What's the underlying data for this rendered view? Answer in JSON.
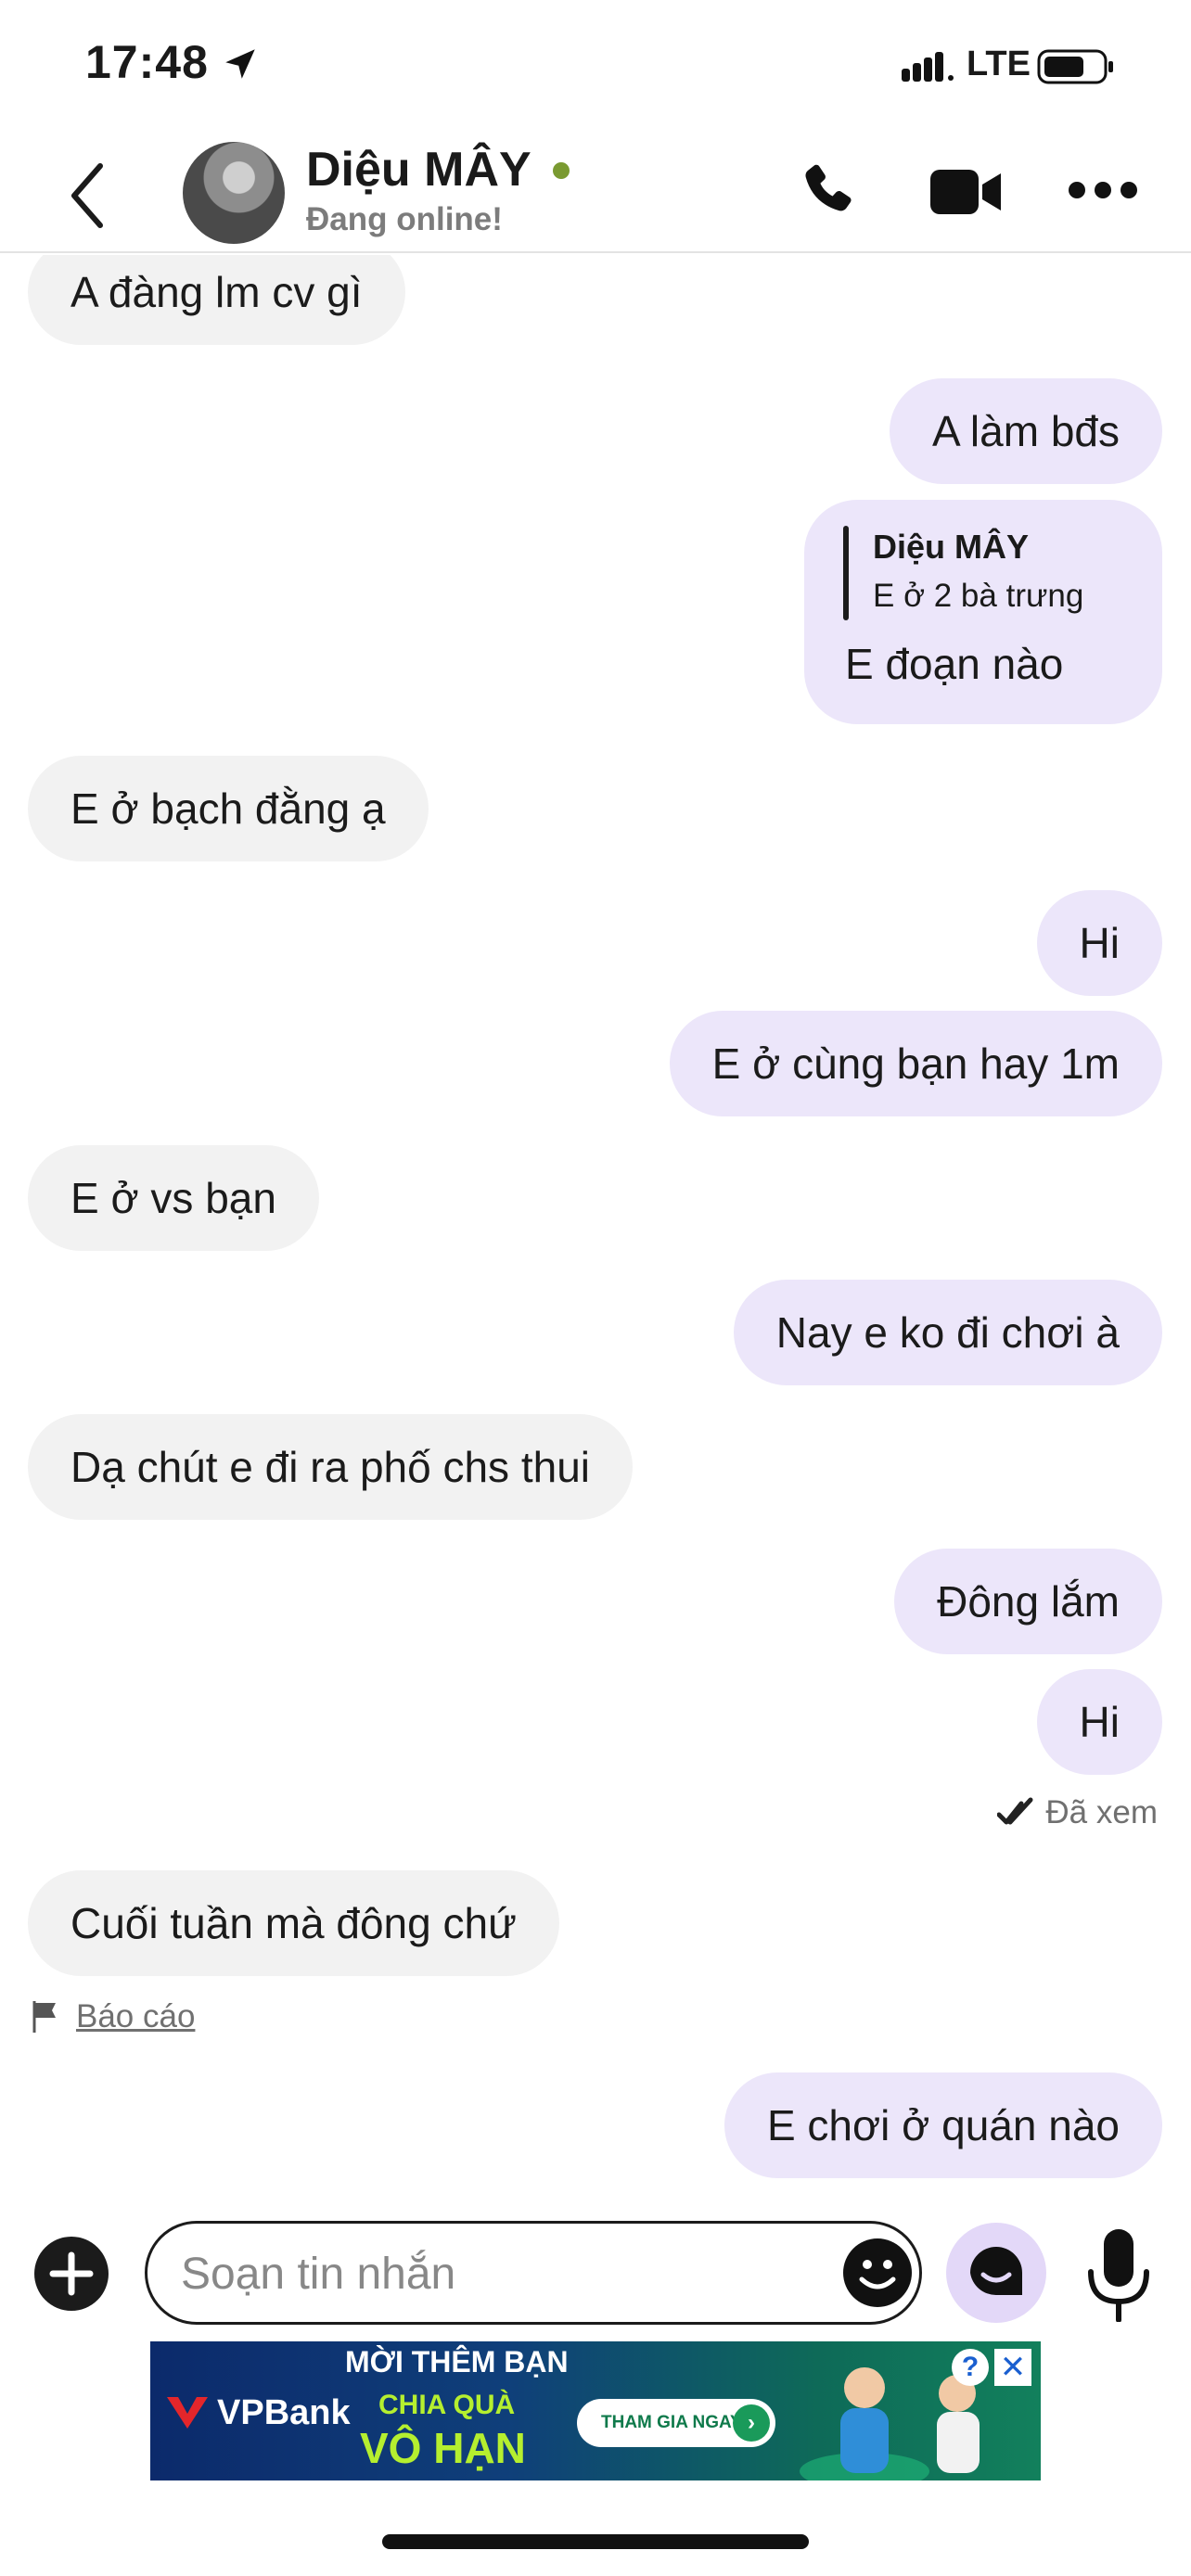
{
  "status_bar": {
    "time": "17:48",
    "network": "LTE"
  },
  "header": {
    "contact_name": "Diệu MÂY",
    "presence": "Đang online!",
    "icons": [
      "back-icon",
      "avatar",
      "phone-icon",
      "video-camera-icon",
      "more-icon"
    ]
  },
  "messages": [
    {
      "side": "in",
      "text": "A đàng lm cv gì"
    },
    {
      "side": "out",
      "text": "A làm bđs"
    },
    {
      "side": "out",
      "reply_to_name": "Diệu MÂY",
      "reply_to_text": "E ở 2 bà trưng",
      "text": "E đoạn nào"
    },
    {
      "side": "in",
      "text": "E ở bạch đằng ạ"
    },
    {
      "side": "out",
      "text": "Hi"
    },
    {
      "side": "out",
      "text": "E ở cùng bạn hay 1m"
    },
    {
      "side": "in",
      "text": "E ở vs bạn"
    },
    {
      "side": "out",
      "text": "Nay e ko đi chơi à"
    },
    {
      "side": "in",
      "text": "Dạ chút e đi ra phố chs thui"
    },
    {
      "side": "out",
      "text": "Đông lắm"
    },
    {
      "side": "out",
      "text": "Hi"
    },
    {
      "side": "in",
      "text": "Cuối tuần mà đông chứ"
    },
    {
      "side": "out",
      "text": "E chơi ở quán nào"
    }
  ],
  "seen_label": "Đã xem",
  "report_label": "Báo cáo",
  "composer": {
    "placeholder": "Soạn tin nhắn",
    "icons": [
      "plus-icon",
      "emoji-icon",
      "sticker-icon",
      "microphone-icon"
    ]
  },
  "ad": {
    "brand": "VPBank",
    "line1": "MỜI THÊM BẠN",
    "line2": "CHIA QUÀ",
    "line3": "VÔ HẠN",
    "cta": "THAM GIA NGAY",
    "info": "?",
    "close": "✕",
    "colors": {
      "background": "#0c2a6b",
      "accent": "#b5ef2f",
      "cta_text": "#0f7a4b"
    }
  },
  "colors": {
    "incoming_bubble": "#f2f2f2",
    "outgoing_bubble": "#ece6fa",
    "online_dot": "#7a9a31",
    "sticker_button": "#e3d8f8"
  }
}
